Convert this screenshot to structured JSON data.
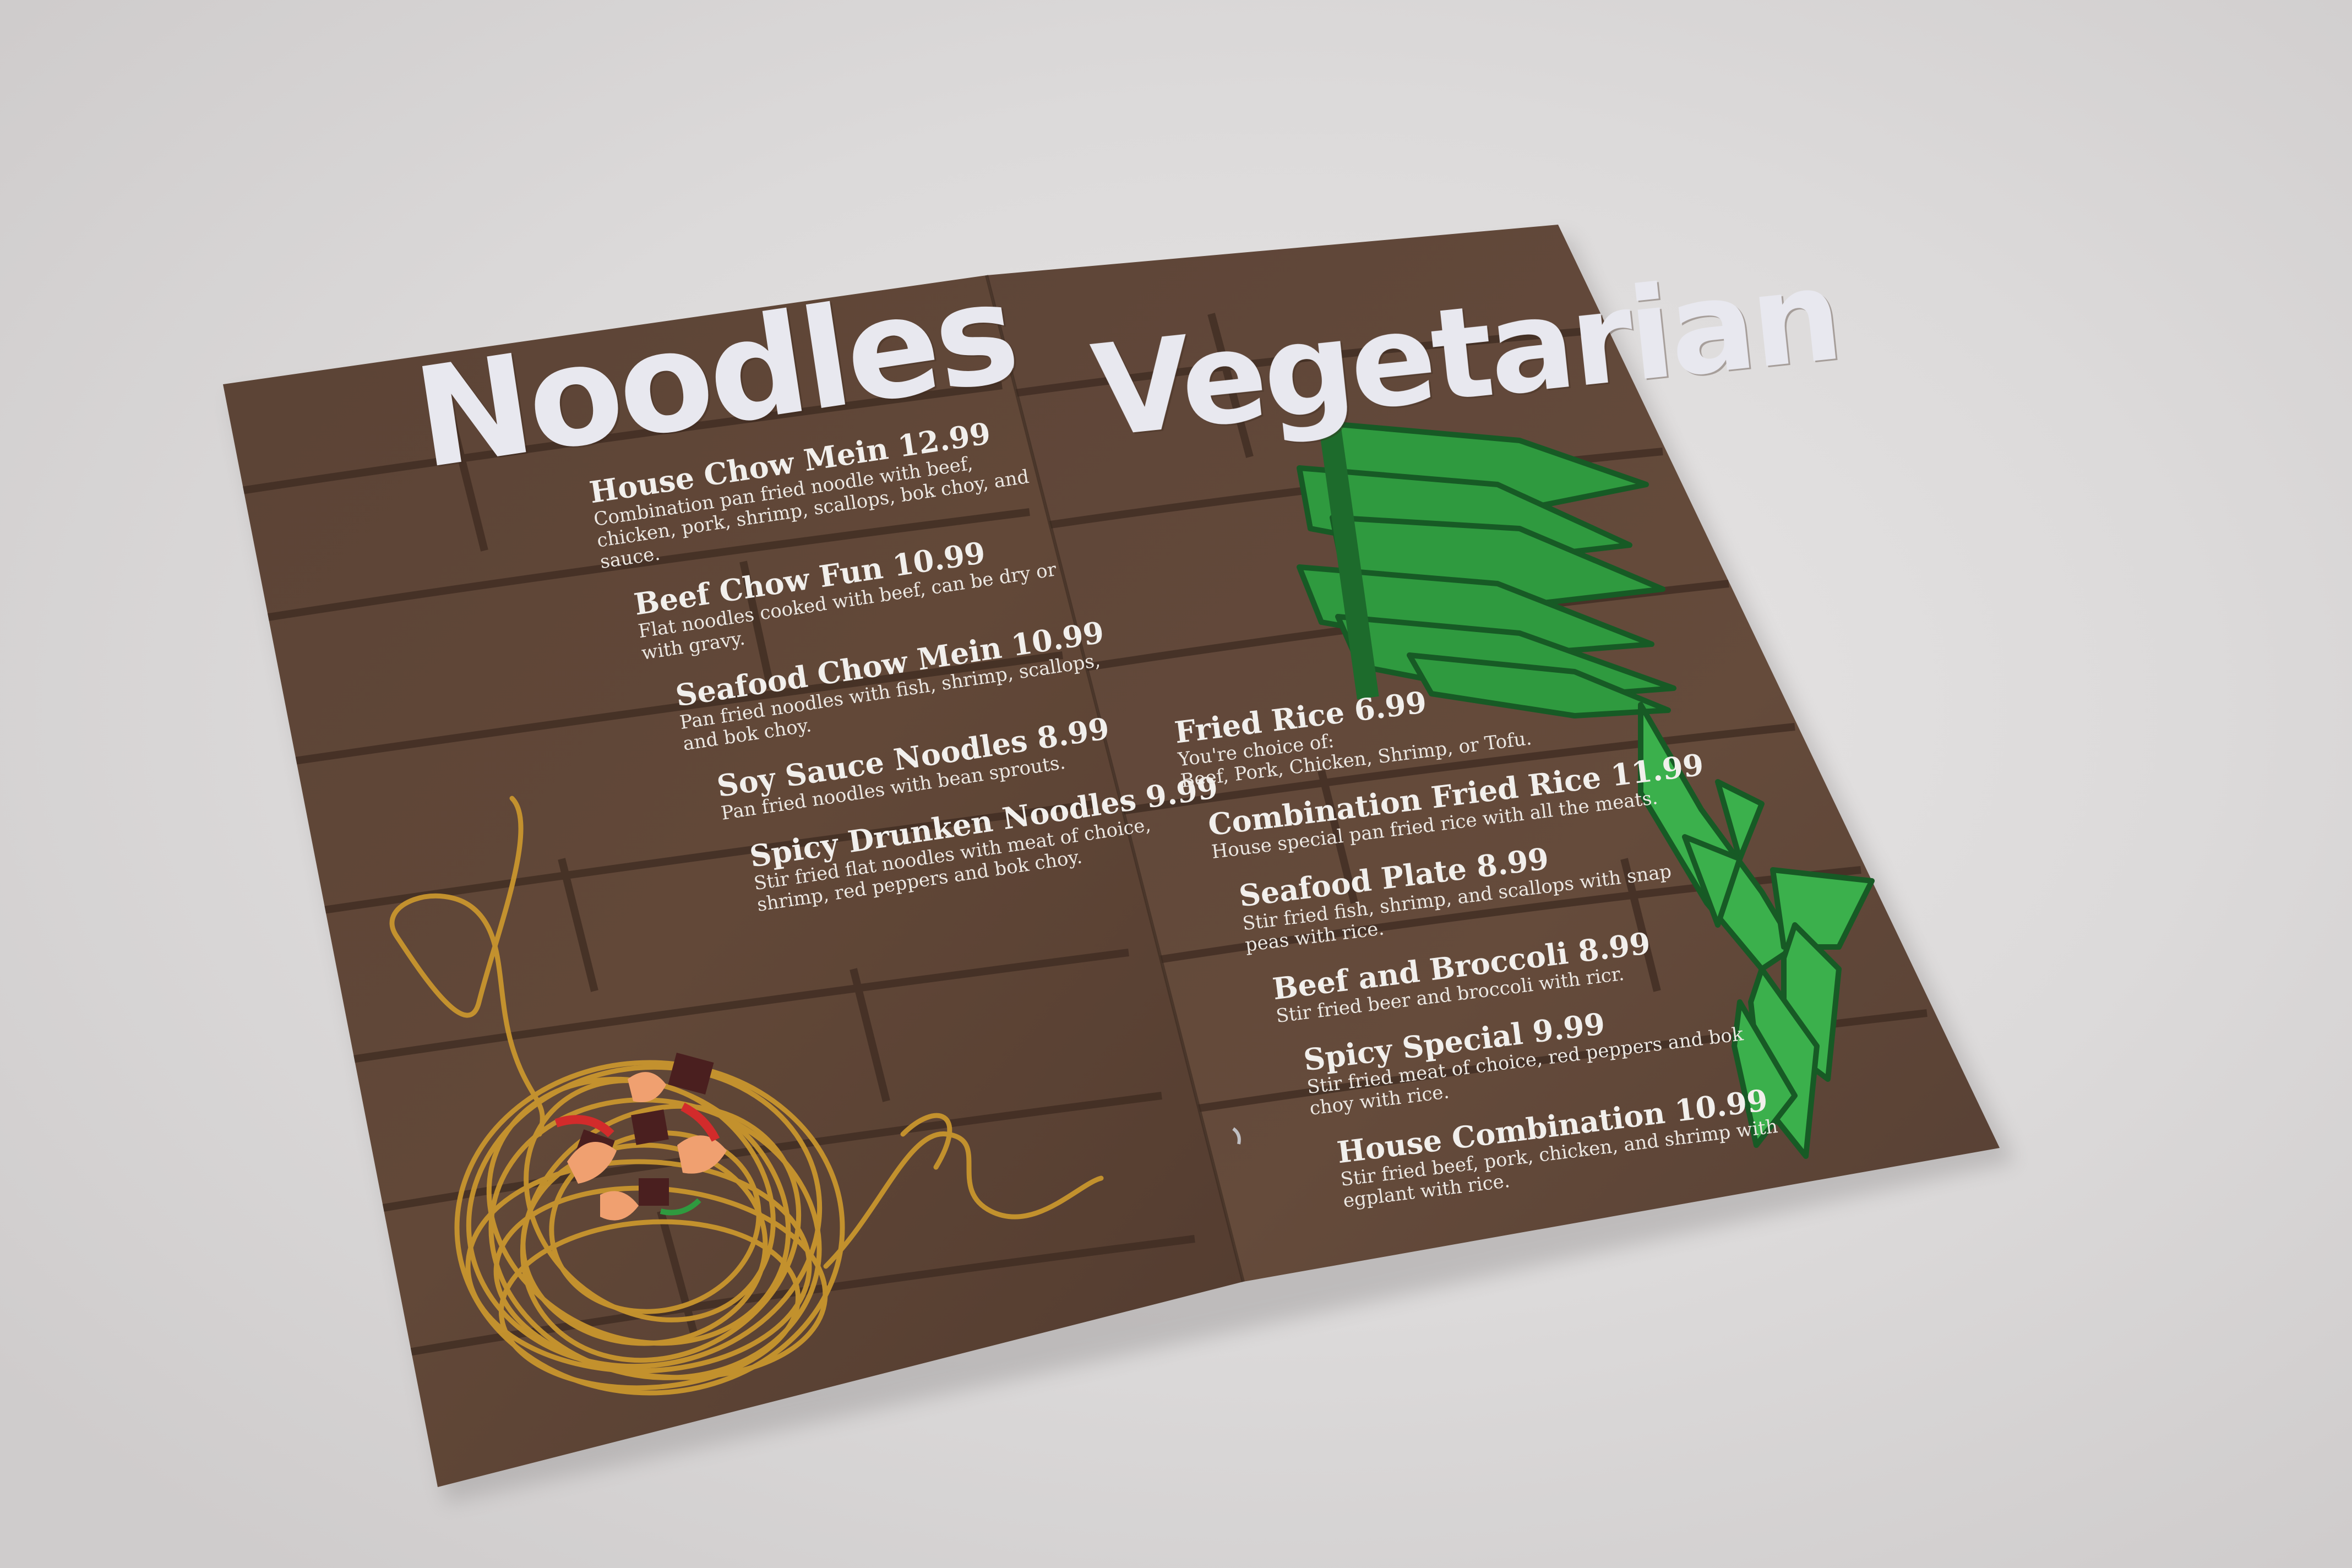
{
  "colors": {
    "background": "#dcdada",
    "wood": "#5a4234",
    "wood_dark": "#3b2a20",
    "title": "#e8e8ef",
    "text": "#f1efec",
    "noodle": "#c9962e",
    "leaf": "#2f9a3f",
    "leaf_dark": "#175a25"
  },
  "left_page": {
    "title": "Noodles",
    "items": [
      {
        "name": "House Chow Mein 12.99",
        "desc": [
          "Combination pan fried noodle with beef,",
          "chicken, pork, shrimp, scallops, bok choy, and",
          "sauce."
        ]
      },
      {
        "name": "Beef Chow Fun 10.99",
        "desc": [
          "Flat noodles cooked with beef, can be dry or",
          "with gravy."
        ]
      },
      {
        "name": "Seafood Chow Mein 10.99",
        "desc": [
          "Pan fried noodles with fish, shrimp, scallops,",
          "and bok choy."
        ]
      },
      {
        "name": "Soy Sauce Noodles 8.99",
        "desc": [
          "Pan fried noodles with bean sprouts."
        ]
      },
      {
        "name": "Spicy Drunken Noodles 9.99",
        "desc": [
          "Stir fried flat noodles with meat of choice,",
          "shrimp, red peppers and bok choy."
        ]
      }
    ]
  },
  "right_page": {
    "title": "Vegetarian",
    "items": [
      {
        "name": "Fried Rice 6.99",
        "desc": [
          "You're choice of:",
          "Beef, Pork, Chicken, Shrimp, or Tofu."
        ]
      },
      {
        "name": "Combination Fried Rice 11.99",
        "desc": [
          "House special pan fried rice with all the meats."
        ]
      },
      {
        "name": "Seafood Plate 8.99",
        "desc": [
          "Stir fried fish, shrimp, and scallops with snap",
          "peas with rice."
        ]
      },
      {
        "name": "Beef and Broccoli 8.99",
        "desc": [
          "Stir fried beer and broccoli with ricr."
        ]
      },
      {
        "name": "Spicy Special 9.99",
        "desc": [
          "Stir fried meat of choice, red peppers and bok",
          "choy with rice."
        ]
      },
      {
        "name": "House Combination 10.99",
        "desc": [
          "Stir fried beef, pork, chicken, and shrimp with",
          "egplant with rice."
        ]
      }
    ]
  },
  "illustrations": {
    "left": "noodle-nest-icon",
    "right": "bok-choy-icon"
  }
}
